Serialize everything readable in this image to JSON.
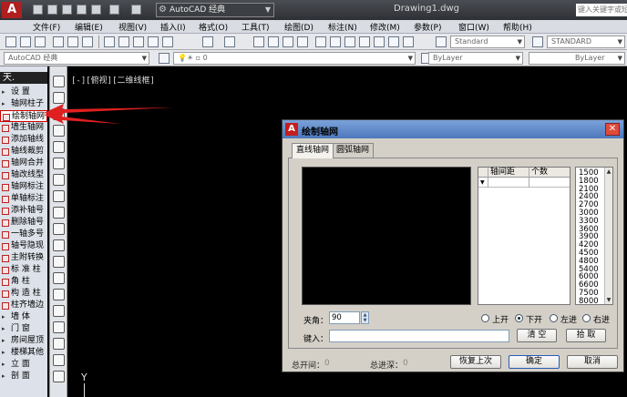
{
  "app": {
    "workspace": "AutoCAD 经典",
    "document_title": "Drawing1.dwg",
    "search_placeholder": "键入关键字或短语"
  },
  "menubar": [
    "文件(F)",
    "编辑(E)",
    "视图(V)",
    "插入(I)",
    "格式(O)",
    "工具(T)",
    "绘图(D)",
    "标注(N)",
    "修改(M)",
    "参数(P)",
    "窗口(W)",
    "帮助(H)"
  ],
  "toolbar": {
    "text_style": "Standard",
    "dim_style": "STANDARD",
    "workspace_select": "AutoCAD 经典",
    "layer": "0",
    "color": "ByLayer",
    "linetype": "ByLayer"
  },
  "drawing": {
    "viewport_label": "[-][俯视][二维线框]",
    "ucs_y": "Y"
  },
  "left_panel": {
    "header": "天.",
    "items": [
      {
        "label": "设    置",
        "type": "cat"
      },
      {
        "label": "轴网柱子",
        "type": "cat"
      },
      {
        "label": "绘制轴网",
        "type": "item",
        "selected": true
      },
      {
        "label": "墙生轴网",
        "type": "item"
      },
      {
        "label": "添加轴线",
        "type": "item"
      },
      {
        "label": "轴线裁剪",
        "type": "item"
      },
      {
        "label": "轴网合并",
        "type": "item"
      },
      {
        "label": "轴改线型",
        "type": "item"
      },
      {
        "label": "轴网标注",
        "type": "item"
      },
      {
        "label": "单轴标注",
        "type": "item"
      },
      {
        "label": "添补轴号",
        "type": "item"
      },
      {
        "label": "删除轴号",
        "type": "item"
      },
      {
        "label": "一轴多号",
        "type": "item"
      },
      {
        "label": "轴号隐现",
        "type": "item"
      },
      {
        "label": "主附转换",
        "type": "item"
      },
      {
        "label": "标 准 柱",
        "type": "item"
      },
      {
        "label": "角    柱",
        "type": "item"
      },
      {
        "label": "构 造 柱",
        "type": "item"
      },
      {
        "label": "柱齐墙边",
        "type": "item"
      },
      {
        "label": "墙    体",
        "type": "cat"
      },
      {
        "label": "门    窗",
        "type": "cat"
      },
      {
        "label": "房间屋顶",
        "type": "cat"
      },
      {
        "label": "楼梯其他",
        "type": "cat"
      },
      {
        "label": "立    面",
        "type": "cat"
      },
      {
        "label": "剖    面",
        "type": "cat"
      }
    ]
  },
  "dialog": {
    "title": "绘制轴网",
    "tabs": [
      "直线轴网",
      "圆弧轴网"
    ],
    "table_headers": [
      "轴间距",
      "个数"
    ],
    "values": [
      "1500",
      "1800",
      "2100",
      "2400",
      "2700",
      "3000",
      "3300",
      "3600",
      "3900",
      "4200",
      "4500",
      "4800",
      "5400",
      "6000",
      "6600",
      "7500",
      "8000"
    ],
    "angle_label": "夹角：",
    "angle_value": "90",
    "radios": [
      {
        "label": "上开",
        "checked": false
      },
      {
        "label": "下开",
        "checked": true
      },
      {
        "label": "左进",
        "checked": false
      },
      {
        "label": "右进",
        "checked": false
      }
    ],
    "input_label": "键入：",
    "clear_label": "清  空",
    "pick_label": "拾  取",
    "total_open_label": "总开间：",
    "total_open_value": "0",
    "total_depth_label": "总进深：",
    "total_depth_value": "0",
    "restore_label": "恢复上次",
    "ok_label": "确定",
    "cancel_label": "取消"
  }
}
